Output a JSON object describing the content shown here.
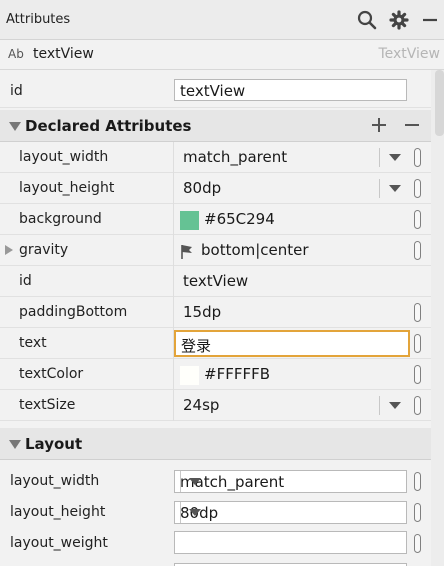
{
  "panel": {
    "title": "Attributes"
  },
  "component": {
    "icon_text": "Ab",
    "name": "textView",
    "type": "TextView"
  },
  "id_row": {
    "label": "id",
    "value": "textView"
  },
  "declared": {
    "title": "Declared Attributes",
    "rows": [
      {
        "label": "layout_width",
        "value": "match_parent"
      },
      {
        "label": "layout_height",
        "value": "80dp"
      },
      {
        "label": "background",
        "value": "#65C294",
        "swatch": "#65C294"
      },
      {
        "label": "gravity",
        "value": "bottom|center"
      },
      {
        "label": "id",
        "value": "textView"
      },
      {
        "label": "paddingBottom",
        "value": "15dp"
      },
      {
        "label": "text",
        "value": "登录"
      },
      {
        "label": "textColor",
        "value": "#FFFFFB",
        "swatch": "#FFFFFB"
      },
      {
        "label": "textSize",
        "value": "24sp"
      }
    ]
  },
  "layout": {
    "title": "Layout",
    "rows": [
      {
        "label": "layout_width",
        "value": "match_parent"
      },
      {
        "label": "layout_height",
        "value": "80dp"
      },
      {
        "label": "layout_weight",
        "value": ""
      }
    ]
  },
  "colors": {
    "focus_border": "#E3A43A",
    "accent_green": "#65C294"
  }
}
